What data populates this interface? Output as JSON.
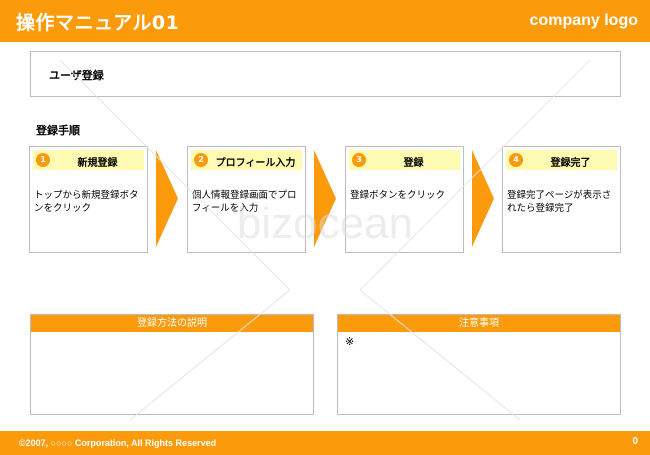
{
  "header": {
    "title": "操作マニュアル01",
    "logo_text": "company logo"
  },
  "topic": {
    "label": "ユーザ登録"
  },
  "procedure": {
    "label": "登録手順",
    "steps": [
      {
        "number": "1",
        "title": "新規登録",
        "description": "トップから新規登録ボタンをクリック"
      },
      {
        "number": "2",
        "title": "プロフィール入力",
        "description": "個人情報登録画面でプロフィールを入力"
      },
      {
        "number": "3",
        "title": "登録",
        "description": "登録ボタンをクリック"
      },
      {
        "number": "4",
        "title": "登録完了",
        "description": "登録完了ページが表示されたら登録完了"
      }
    ]
  },
  "panels": {
    "explanation": {
      "title": "登録方法の説明",
      "body": ""
    },
    "notes": {
      "title": "注意事項",
      "body": "※"
    }
  },
  "watermark": {
    "text": "bizocean"
  },
  "footer": {
    "copyright": "©2007, ○○○○ Corporation, All Rights Reserved",
    "page_number": "0"
  },
  "colors": {
    "accent": "#fb9a0b",
    "step_header": "#fffab2",
    "border": "#bdbdbd"
  }
}
